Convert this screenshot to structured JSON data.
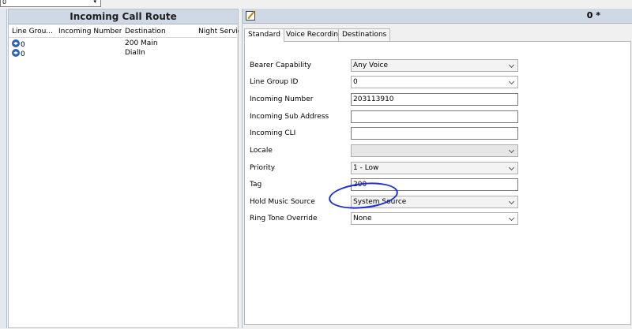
{
  "topbar": {
    "combo_value": "0"
  },
  "left": {
    "title": "Incoming Call Route",
    "columns": [
      "Line Grou...",
      "Incoming Number",
      "Destination",
      "Night Service"
    ],
    "rows": [
      {
        "line_group": "0",
        "incoming_number": "",
        "destination": "200 Main"
      },
      {
        "line_group": "0",
        "incoming_number": "",
        "destination": "DialIn"
      }
    ]
  },
  "right": {
    "count": "0 *",
    "tabs": [
      "Standard",
      "Voice Recording",
      "Destinations"
    ],
    "fields": {
      "bearer_capability": {
        "label": "Bearer Capability",
        "value": "Any Voice"
      },
      "line_group_id": {
        "label": "Line Group ID",
        "value": "0"
      },
      "incoming_number": {
        "label": "Incoming Number",
        "value": "203113910"
      },
      "incoming_sub_address": {
        "label": "Incoming Sub Address",
        "value": ""
      },
      "incoming_cli": {
        "label": "Incoming CLI",
        "value": ""
      },
      "locale": {
        "label": "Locale",
        "value": ""
      },
      "priority": {
        "label": "Priority",
        "value": "1 - Low"
      },
      "tag": {
        "label": "Tag",
        "value": "200"
      },
      "hold_music_source": {
        "label": "Hold Music Source",
        "value": "System Source"
      },
      "ring_tone_override": {
        "label": "Ring Tone Override",
        "value": "None"
      }
    }
  },
  "colors": {
    "header_bg": "#cfd8e5",
    "annotation": "#1f2fd6",
    "route_icon": "#2f62b5"
  },
  "icons": {
    "route": "route-icon",
    "edit": "edit-icon",
    "dropdown": "chevron-down-icon"
  }
}
